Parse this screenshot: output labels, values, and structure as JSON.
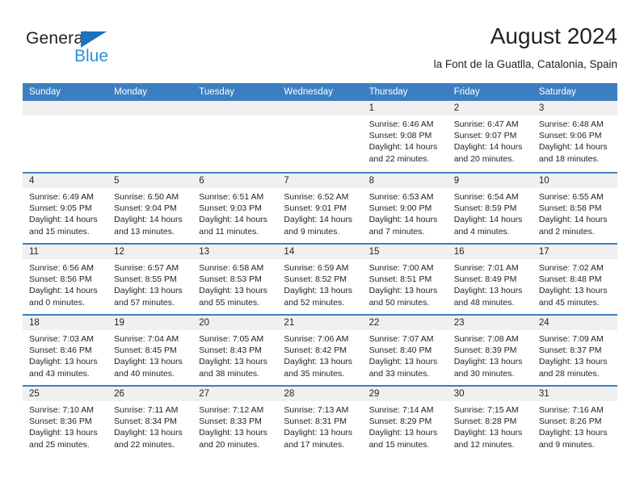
{
  "brand": {
    "name_top": "General",
    "name_bottom": "Blue",
    "accent_color": "#2a8fd4",
    "triangle_color": "#1c72bd"
  },
  "header": {
    "title": "August 2024",
    "subtitle": "la Font de la Guatlla, Catalonia, Spain"
  },
  "theme": {
    "header_row_bg": "#3c7fc1",
    "day_strip_bg": "#f0f0f0",
    "text_color": "#231f20"
  },
  "weekdays": [
    "Sunday",
    "Monday",
    "Tuesday",
    "Wednesday",
    "Thursday",
    "Friday",
    "Saturday"
  ],
  "weeks": [
    [
      {
        "day": "",
        "sunrise": "",
        "sunset": "",
        "daylight_line1": "",
        "daylight_line2": ""
      },
      {
        "day": "",
        "sunrise": "",
        "sunset": "",
        "daylight_line1": "",
        "daylight_line2": ""
      },
      {
        "day": "",
        "sunrise": "",
        "sunset": "",
        "daylight_line1": "",
        "daylight_line2": ""
      },
      {
        "day": "",
        "sunrise": "",
        "sunset": "",
        "daylight_line1": "",
        "daylight_line2": ""
      },
      {
        "day": "1",
        "sunrise": "Sunrise: 6:46 AM",
        "sunset": "Sunset: 9:08 PM",
        "daylight_line1": "Daylight: 14 hours",
        "daylight_line2": "and 22 minutes."
      },
      {
        "day": "2",
        "sunrise": "Sunrise: 6:47 AM",
        "sunset": "Sunset: 9:07 PM",
        "daylight_line1": "Daylight: 14 hours",
        "daylight_line2": "and 20 minutes."
      },
      {
        "day": "3",
        "sunrise": "Sunrise: 6:48 AM",
        "sunset": "Sunset: 9:06 PM",
        "daylight_line1": "Daylight: 14 hours",
        "daylight_line2": "and 18 minutes."
      }
    ],
    [
      {
        "day": "4",
        "sunrise": "Sunrise: 6:49 AM",
        "sunset": "Sunset: 9:05 PM",
        "daylight_line1": "Daylight: 14 hours",
        "daylight_line2": "and 15 minutes."
      },
      {
        "day": "5",
        "sunrise": "Sunrise: 6:50 AM",
        "sunset": "Sunset: 9:04 PM",
        "daylight_line1": "Daylight: 14 hours",
        "daylight_line2": "and 13 minutes."
      },
      {
        "day": "6",
        "sunrise": "Sunrise: 6:51 AM",
        "sunset": "Sunset: 9:03 PM",
        "daylight_line1": "Daylight: 14 hours",
        "daylight_line2": "and 11 minutes."
      },
      {
        "day": "7",
        "sunrise": "Sunrise: 6:52 AM",
        "sunset": "Sunset: 9:01 PM",
        "daylight_line1": "Daylight: 14 hours",
        "daylight_line2": "and 9 minutes."
      },
      {
        "day": "8",
        "sunrise": "Sunrise: 6:53 AM",
        "sunset": "Sunset: 9:00 PM",
        "daylight_line1": "Daylight: 14 hours",
        "daylight_line2": "and 7 minutes."
      },
      {
        "day": "9",
        "sunrise": "Sunrise: 6:54 AM",
        "sunset": "Sunset: 8:59 PM",
        "daylight_line1": "Daylight: 14 hours",
        "daylight_line2": "and 4 minutes."
      },
      {
        "day": "10",
        "sunrise": "Sunrise: 6:55 AM",
        "sunset": "Sunset: 8:58 PM",
        "daylight_line1": "Daylight: 14 hours",
        "daylight_line2": "and 2 minutes."
      }
    ],
    [
      {
        "day": "11",
        "sunrise": "Sunrise: 6:56 AM",
        "sunset": "Sunset: 8:56 PM",
        "daylight_line1": "Daylight: 14 hours",
        "daylight_line2": "and 0 minutes."
      },
      {
        "day": "12",
        "sunrise": "Sunrise: 6:57 AM",
        "sunset": "Sunset: 8:55 PM",
        "daylight_line1": "Daylight: 13 hours",
        "daylight_line2": "and 57 minutes."
      },
      {
        "day": "13",
        "sunrise": "Sunrise: 6:58 AM",
        "sunset": "Sunset: 8:53 PM",
        "daylight_line1": "Daylight: 13 hours",
        "daylight_line2": "and 55 minutes."
      },
      {
        "day": "14",
        "sunrise": "Sunrise: 6:59 AM",
        "sunset": "Sunset: 8:52 PM",
        "daylight_line1": "Daylight: 13 hours",
        "daylight_line2": "and 52 minutes."
      },
      {
        "day": "15",
        "sunrise": "Sunrise: 7:00 AM",
        "sunset": "Sunset: 8:51 PM",
        "daylight_line1": "Daylight: 13 hours",
        "daylight_line2": "and 50 minutes."
      },
      {
        "day": "16",
        "sunrise": "Sunrise: 7:01 AM",
        "sunset": "Sunset: 8:49 PM",
        "daylight_line1": "Daylight: 13 hours",
        "daylight_line2": "and 48 minutes."
      },
      {
        "day": "17",
        "sunrise": "Sunrise: 7:02 AM",
        "sunset": "Sunset: 8:48 PM",
        "daylight_line1": "Daylight: 13 hours",
        "daylight_line2": "and 45 minutes."
      }
    ],
    [
      {
        "day": "18",
        "sunrise": "Sunrise: 7:03 AM",
        "sunset": "Sunset: 8:46 PM",
        "daylight_line1": "Daylight: 13 hours",
        "daylight_line2": "and 43 minutes."
      },
      {
        "day": "19",
        "sunrise": "Sunrise: 7:04 AM",
        "sunset": "Sunset: 8:45 PM",
        "daylight_line1": "Daylight: 13 hours",
        "daylight_line2": "and 40 minutes."
      },
      {
        "day": "20",
        "sunrise": "Sunrise: 7:05 AM",
        "sunset": "Sunset: 8:43 PM",
        "daylight_line1": "Daylight: 13 hours",
        "daylight_line2": "and 38 minutes."
      },
      {
        "day": "21",
        "sunrise": "Sunrise: 7:06 AM",
        "sunset": "Sunset: 8:42 PM",
        "daylight_line1": "Daylight: 13 hours",
        "daylight_line2": "and 35 minutes."
      },
      {
        "day": "22",
        "sunrise": "Sunrise: 7:07 AM",
        "sunset": "Sunset: 8:40 PM",
        "daylight_line1": "Daylight: 13 hours",
        "daylight_line2": "and 33 minutes."
      },
      {
        "day": "23",
        "sunrise": "Sunrise: 7:08 AM",
        "sunset": "Sunset: 8:39 PM",
        "daylight_line1": "Daylight: 13 hours",
        "daylight_line2": "and 30 minutes."
      },
      {
        "day": "24",
        "sunrise": "Sunrise: 7:09 AM",
        "sunset": "Sunset: 8:37 PM",
        "daylight_line1": "Daylight: 13 hours",
        "daylight_line2": "and 28 minutes."
      }
    ],
    [
      {
        "day": "25",
        "sunrise": "Sunrise: 7:10 AM",
        "sunset": "Sunset: 8:36 PM",
        "daylight_line1": "Daylight: 13 hours",
        "daylight_line2": "and 25 minutes."
      },
      {
        "day": "26",
        "sunrise": "Sunrise: 7:11 AM",
        "sunset": "Sunset: 8:34 PM",
        "daylight_line1": "Daylight: 13 hours",
        "daylight_line2": "and 22 minutes."
      },
      {
        "day": "27",
        "sunrise": "Sunrise: 7:12 AM",
        "sunset": "Sunset: 8:33 PM",
        "daylight_line1": "Daylight: 13 hours",
        "daylight_line2": "and 20 minutes."
      },
      {
        "day": "28",
        "sunrise": "Sunrise: 7:13 AM",
        "sunset": "Sunset: 8:31 PM",
        "daylight_line1": "Daylight: 13 hours",
        "daylight_line2": "and 17 minutes."
      },
      {
        "day": "29",
        "sunrise": "Sunrise: 7:14 AM",
        "sunset": "Sunset: 8:29 PM",
        "daylight_line1": "Daylight: 13 hours",
        "daylight_line2": "and 15 minutes."
      },
      {
        "day": "30",
        "sunrise": "Sunrise: 7:15 AM",
        "sunset": "Sunset: 8:28 PM",
        "daylight_line1": "Daylight: 13 hours",
        "daylight_line2": "and 12 minutes."
      },
      {
        "day": "31",
        "sunrise": "Sunrise: 7:16 AM",
        "sunset": "Sunset: 8:26 PM",
        "daylight_line1": "Daylight: 13 hours",
        "daylight_line2": "and 9 minutes."
      }
    ]
  ]
}
